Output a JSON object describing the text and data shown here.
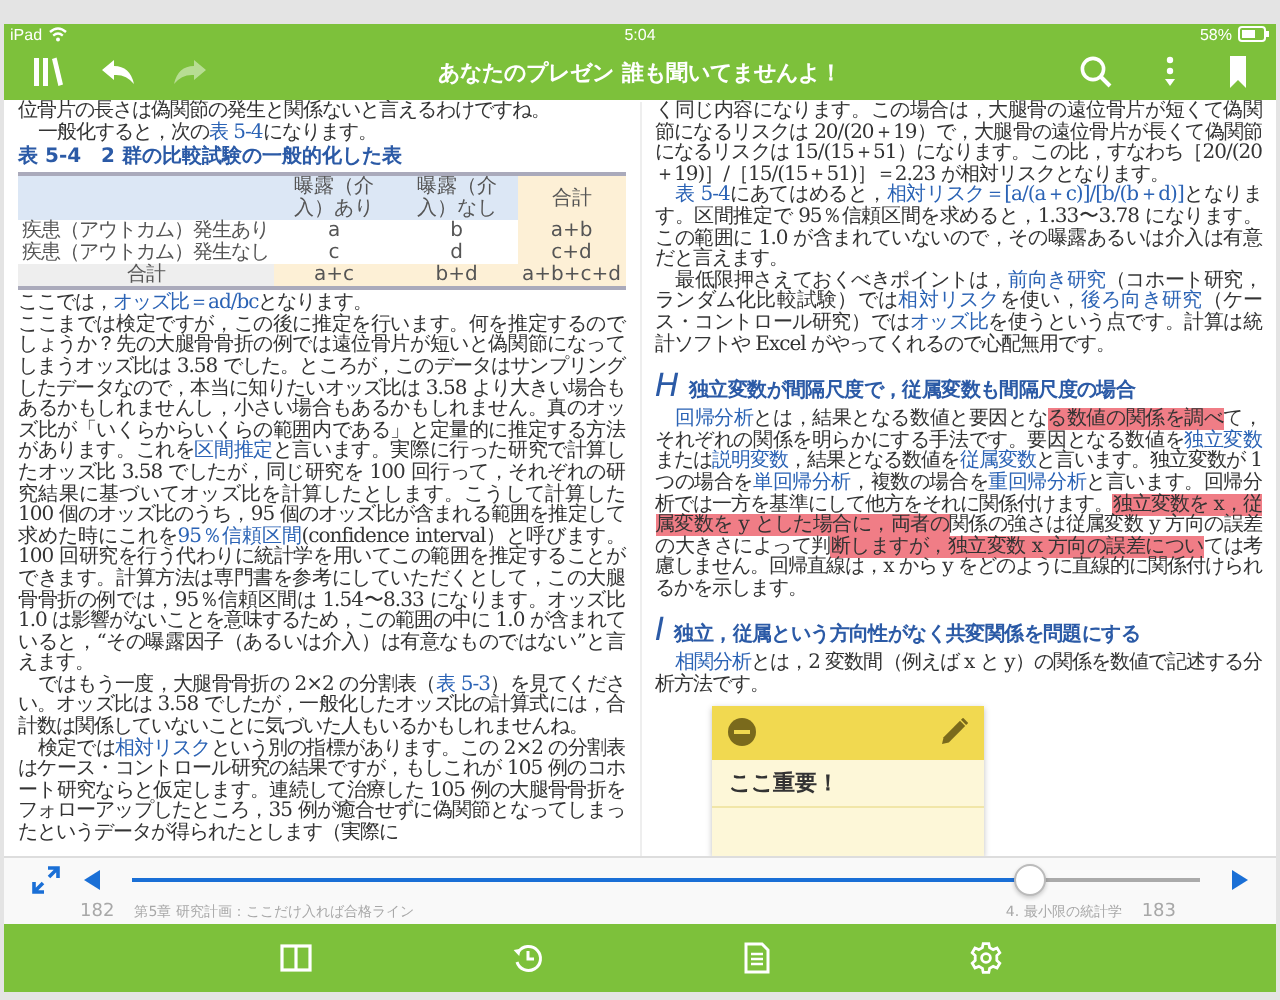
{
  "status_bar": {
    "device": "iPad",
    "time": "5:04",
    "battery": "58%"
  },
  "toolbar": {
    "title": "あなたのプレゼン 誰も聞いてませんよ！",
    "forward_disabled": true
  },
  "left_column": [
    {
      "kind": "para",
      "indent": false,
      "segments": [
        {
          "kind": "plain",
          "text": "位骨片の長さは偽関節の発生と関係ないと言えるわけですね。"
        }
      ]
    },
    {
      "kind": "para",
      "indent": true,
      "segments": [
        {
          "kind": "plain",
          "text": "一般化すると，次の"
        },
        {
          "kind": "term",
          "text": "表 5-4"
        },
        {
          "kind": "plain",
          "text": "になります。"
        }
      ]
    },
    {
      "kind": "table",
      "caption": "表 5-4　2 群の比較試験の一般的化した表",
      "columns": [
        "",
        "曝露（介入）あり",
        "曝露（介入）なし",
        "合計"
      ],
      "rows": [
        [
          "疾患（アウトカム）発生あり",
          "a",
          "b",
          "a+b"
        ],
        [
          "疾患（アウトカム）発生なし",
          "c",
          "d",
          "c+d"
        ],
        [
          "合計",
          "a+c",
          "b+d",
          "a+b+c+d"
        ]
      ]
    },
    {
      "kind": "para",
      "indent": false,
      "segments": [
        {
          "kind": "plain",
          "text": "ここでは，"
        },
        {
          "kind": "term",
          "text": "オッズ比＝ad/bc"
        },
        {
          "kind": "plain",
          "text": "となります。"
        }
      ]
    },
    {
      "kind": "para",
      "indent": false,
      "segments": [
        {
          "kind": "plain",
          "text": "ここまでは検定ですが，この後に推定を行います。何を推定するのでしょうか？先の大腿骨骨折の例では遠位骨片が短いと偽関節になってしまうオッズ比は 3.58 でした。ところが，このデータはサンプリングしたデータなので，本当に知りたいオッズ比は 3.58 より大きい場合もあるかもしれませんし，小さい場合もあるかもしれません。真のオッズ比が「いくらからいくらの範囲内である」と定量的に推定する方法があります。これを"
        },
        {
          "kind": "term",
          "text": "区間推定"
        },
        {
          "kind": "plain",
          "text": "と言います。実際に行った研究で計算したオッズ比 3.58 でしたが，同じ研究を 100 回行って，それぞれの研究結果に基づいてオッズ比を計算したとします。こうして計算した 100 個のオッズ比のうち，95 個のオッズ比が含まれる範囲を推定して求めた時にこれを"
        },
        {
          "kind": "term",
          "text": "95％信頼区間"
        },
        {
          "kind": "plain",
          "text": "(confidence interval）と呼びます。100 回研究を行う代わりに統計学を用いてこの範囲を推定することができます。計算方法は専門書を参考にしていただくとして，この大腿骨骨折の例では，95％信頼区間は 1.54〜8.33 になります。オッズ比 1.0 は影響がないことを意味するため，この範囲の中に 1.0 が含まれていると，“その曝露因子（あるいは介入）は有意なものではない”と言えます。"
        }
      ]
    },
    {
      "kind": "para",
      "indent": true,
      "segments": [
        {
          "kind": "plain",
          "text": "ではもう一度，大腿骨骨折の 2×2 の分割表（"
        },
        {
          "kind": "term",
          "text": "表 5-3"
        },
        {
          "kind": "plain",
          "text": "）を見てください。オッズ比は 3.58 でしたが，一般化したオッズ比の計算式には，合計数は関係していないことに気づいた人もいるかもしれませんね。"
        }
      ]
    },
    {
      "kind": "para",
      "indent": true,
      "segments": [
        {
          "kind": "plain",
          "text": "検定では"
        },
        {
          "kind": "term",
          "text": "相対リスク"
        },
        {
          "kind": "plain",
          "text": "という別の指標があります。この 2×2 の分割表はケース・コントロール研究の結果ですが，もしこれが 105 例のコホート研究ならと仮定します。連続して治療した 105 例の大腿骨骨折をフォローアップしたところ，35 例が癒合せずに偽関節となってしまったというデータが得られたとします（実際に"
        }
      ]
    }
  ],
  "right_column": [
    {
      "kind": "para",
      "indent": false,
      "segments": [
        {
          "kind": "plain",
          "text": "く同じ内容になります。この場合は，大腿骨の遠位骨片が短くて偽関節になるリスクは 20/(20＋19）で，大腿骨の遠位骨片が長くて偽関節になるリスクは 15/(15＋51）になります。この比，すなわち［20/(20＋19)］/［15/(15＋51)］＝2.23 が相対リスクとなります。"
        }
      ]
    },
    {
      "kind": "para",
      "indent": true,
      "segments": [
        {
          "kind": "term",
          "text": "表 5-4"
        },
        {
          "kind": "plain",
          "text": "にあてはめると，"
        },
        {
          "kind": "term",
          "text": "相対リスク＝[a/(a＋c)]/[b/(b＋d)]"
        },
        {
          "kind": "plain",
          "text": "となります。区間推定で 95％信頼区間を求めると，1.33〜3.78 になります。この範囲に 1.0 が含まれていないので，その曝露あるいは介入は有意だと言えます。"
        }
      ]
    },
    {
      "kind": "para",
      "indent": true,
      "segments": [
        {
          "kind": "plain",
          "text": "最低限押さえておくべきポイントは，"
        },
        {
          "kind": "term",
          "text": "前向き研究"
        },
        {
          "kind": "plain",
          "text": "（コホート研究，ランダム化比較試験）では"
        },
        {
          "kind": "term",
          "text": "相対リスク"
        },
        {
          "kind": "plain",
          "text": "を使い，"
        },
        {
          "kind": "term",
          "text": "後ろ向き研究"
        },
        {
          "kind": "plain",
          "text": "（ケース・コントロール研究）では"
        },
        {
          "kind": "term",
          "text": "オッズ比"
        },
        {
          "kind": "plain",
          "text": "を使うという点です。計算は統計ソフトや Excel がやってくれるので心配無用です。"
        }
      ]
    },
    {
      "kind": "heading",
      "letter": "H",
      "text": "独立変数が間隔尺度で，従属変数も間隔尺度の場合"
    },
    {
      "kind": "para",
      "indent": true,
      "segments": [
        {
          "kind": "term",
          "text": "回帰分析"
        },
        {
          "kind": "plain",
          "text": "とは，結果となる数値と要因とな"
        },
        {
          "kind": "highlight",
          "text": "る数値の関係を調べ"
        },
        {
          "kind": "plain",
          "text": "て，それぞれの関係を明らかにする手法です。要因となる数値を"
        },
        {
          "kind": "term",
          "text": "独立変数"
        },
        {
          "kind": "plain",
          "text": "または"
        },
        {
          "kind": "term",
          "text": "説明変数"
        },
        {
          "kind": "plain",
          "text": "，結果となる数値を"
        },
        {
          "kind": "term",
          "text": "従属変数"
        },
        {
          "kind": "plain",
          "text": "と言います。独立変数が 1 つの場合を"
        },
        {
          "kind": "term",
          "text": "単回帰分析"
        },
        {
          "kind": "plain",
          "text": "，複数の場合を"
        },
        {
          "kind": "term",
          "text": "重回帰分析"
        },
        {
          "kind": "plain",
          "text": "と言います。回帰分析では一方を基準にして他方をそれに関係付けます。"
        },
        {
          "kind": "highlight",
          "text": "独立変数を x，従属変数を y とした場合に，両者の"
        },
        {
          "kind": "plain",
          "text": "関係の強さは従属変数 y 方向の誤差の大きさによって判"
        },
        {
          "kind": "highlight",
          "text": "断しますが，独立変数 x 方向の誤差につい"
        },
        {
          "kind": "plain",
          "text": "ては考慮しません。回帰直線は，x から y をどのように直線的に関係付けられるかを示します。"
        }
      ]
    },
    {
      "kind": "heading",
      "letter": "I",
      "text": "独立，従属という方向性がなく共変関係を問題にする"
    },
    {
      "kind": "para",
      "indent": true,
      "segments": [
        {
          "kind": "term",
          "text": "相関分析"
        },
        {
          "kind": "plain",
          "text": "とは，2 変数間（例えば x と y）の関係を数値で記述する分析方法です。"
        }
      ]
    }
  ],
  "footer": {
    "left_page": "182",
    "left_chapter": "第5章 研究計画：ここだけ入れば合格ライン",
    "right_chapter": "4. 最小限の統計学",
    "right_page": "183"
  },
  "note": {
    "text": "ここ重要！"
  },
  "slider": {
    "level": 0.84
  }
}
